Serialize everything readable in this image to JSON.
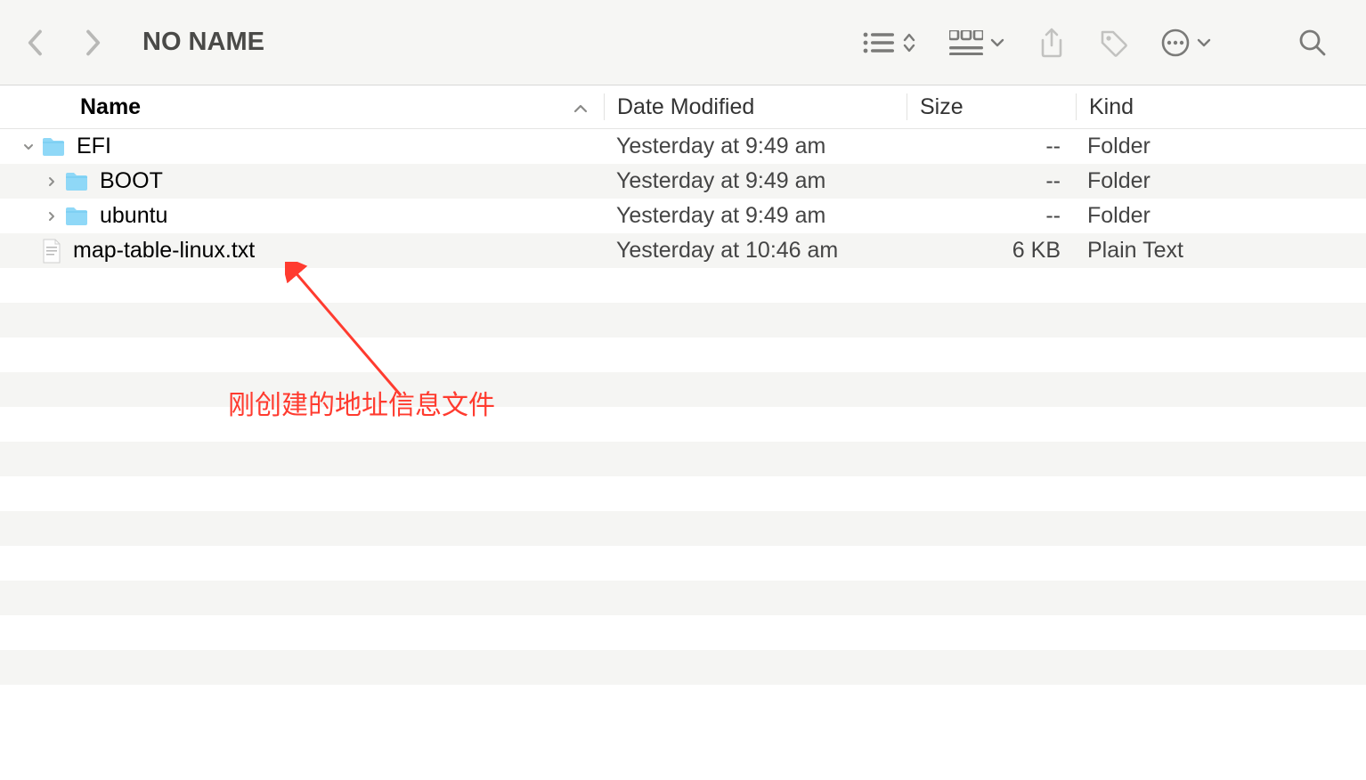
{
  "toolbar": {
    "title": "NO NAME"
  },
  "columns": {
    "name": "Name",
    "date": "Date Modified",
    "size": "Size",
    "kind": "Kind"
  },
  "rows": [
    {
      "name": "EFI",
      "date": "Yesterday at 9:49 am",
      "size": "--",
      "kind": "Folder",
      "type": "folder",
      "indent": 0,
      "expanded": true
    },
    {
      "name": "BOOT",
      "date": "Yesterday at 9:49 am",
      "size": "--",
      "kind": "Folder",
      "type": "folder",
      "indent": 1,
      "expanded": false
    },
    {
      "name": "ubuntu",
      "date": "Yesterday at 9:49 am",
      "size": "--",
      "kind": "Folder",
      "type": "folder",
      "indent": 1,
      "expanded": false
    },
    {
      "name": "map-table-linux.txt",
      "date": "Yesterday at 10:46 am",
      "size": "6 KB",
      "kind": "Plain Text",
      "type": "file",
      "indent": 0,
      "expanded": null
    }
  ],
  "annotation": {
    "text": "刚创建的地址信息文件"
  }
}
